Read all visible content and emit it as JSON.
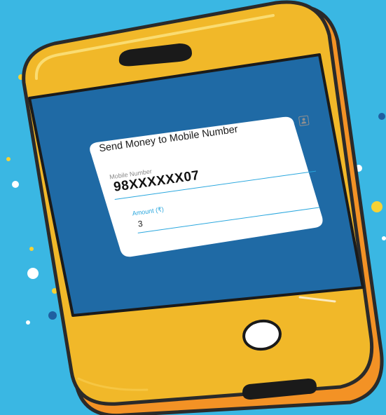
{
  "form": {
    "title": "Send Money to Mobile Number",
    "mobile_label": "Mobile Number",
    "mobile_value": "98XXXXXX07",
    "amount_label": "Amount (₹)",
    "amount_value": "3"
  },
  "icons": {
    "contact": "contact-book-icon"
  },
  "colors": {
    "background": "#3ab7e3",
    "phone_body": "#f1b829",
    "phone_rim": "#f39225",
    "screen": "#1f6aa5",
    "accent": "#2aa7de",
    "card": "#ffffff"
  }
}
